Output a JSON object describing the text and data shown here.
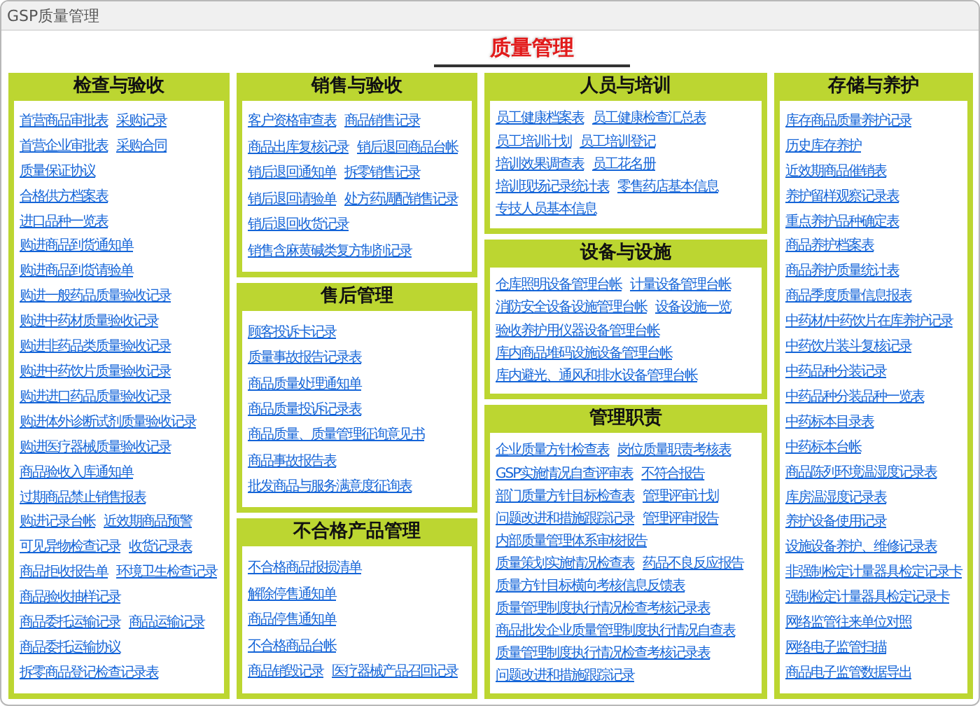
{
  "window": {
    "title": "GSP质量管理"
  },
  "heading": "质量管理",
  "columns": [
    {
      "panels": [
        {
          "title": "检查与验收",
          "rows": [
            [
              "首营商品审批表",
              "采购记录"
            ],
            [
              "首营企业审批表",
              "采购合同"
            ],
            [
              "质量保证协议"
            ],
            [
              "合格供方档案表"
            ],
            [
              "进口品种一览表"
            ],
            [
              "购进商品到货通知单"
            ],
            [
              "购进商品到货请验单"
            ],
            [
              "购进一般药品质量验收记录"
            ],
            [
              "购进中药材质量验收记录"
            ],
            [
              "购进非药品类质量验收记录"
            ],
            [
              "购进中药饮片质量验收记录"
            ],
            [
              "购进进口药品质量验收记录"
            ],
            [
              "购进体外诊断试剂质量验收记录"
            ],
            [
              "购进医疗器械质量验收记录"
            ],
            [
              "商品验收入库通知单"
            ],
            [
              "过期商品禁止销售报表"
            ],
            [
              "购进记录台帐",
              "近效期商品预警"
            ],
            [
              "可见异物检查记录",
              "收货记录表"
            ],
            [
              "商品拒收报告单",
              "环境卫生检查记录"
            ],
            [
              "商品验收抽样记录"
            ],
            [
              "商品委托运输记录",
              "商品运输记录"
            ],
            [
              "商品委托运输协议"
            ],
            [
              "拆零商品登记检查记录表"
            ]
          ]
        }
      ]
    },
    {
      "panels": [
        {
          "title": "销售与验收",
          "rows": [
            [
              "客户资格审查表",
              "商品销售记录"
            ],
            [
              "商品出库复核记录",
              "销后退回商品台帐"
            ],
            [
              "销后退回通知单",
              "拆零销售记录"
            ],
            [
              "销后退回请验单",
              "处方药调配销售记录"
            ],
            [
              "销后退回收货记录"
            ],
            [
              "销售含麻黄碱类复方制剂记录"
            ]
          ]
        },
        {
          "title": "售后管理",
          "rows": [
            [
              "顾客投诉卡记录"
            ],
            [
              "质量事故报告记录表"
            ],
            [
              "商品质量处理通知单"
            ],
            [
              "商品质量投诉记录表"
            ],
            [
              "商品质量、质量管理征询意见书"
            ],
            [
              "商品事故报告表"
            ],
            [
              "批发商品与服务满意度征询表"
            ]
          ]
        },
        {
          "title": "不合格产品管理",
          "rows": [
            [
              "不合格商品报损清单"
            ],
            [
              "解除停售通知单"
            ],
            [
              "商品停售通知单"
            ],
            [
              "不合格商品台帐"
            ],
            [
              "商品销毁记录",
              "医疗器械产品召回记录"
            ]
          ]
        }
      ]
    },
    {
      "panels": [
        {
          "title": "人员与培训",
          "rows": [
            [
              "员工健康档案表",
              "员工健康检查汇总表"
            ],
            [
              "员工培训计划",
              "员工培训登记"
            ],
            [
              "培训效果调查表",
              "员工花名册"
            ],
            [
              "培训现场记录统计表",
              "零售药店基本信息"
            ],
            [
              "专技人员基本信息"
            ]
          ]
        },
        {
          "title": "设备与设施",
          "rows": [
            [
              "仓库照明设备管理台帐",
              "计量设备管理台帐"
            ],
            [
              "消防安全设备设施管理台帐",
              "设备设施一览"
            ],
            [
              "验收养护用仪器设备管理台帐"
            ],
            [
              "库内商品堆码设施设备管理台帐"
            ],
            [
              "库内避光、通风和排水设备管理台帐"
            ]
          ]
        },
        {
          "title": "管理职责",
          "rows": [
            [
              "企业质量方针检查表",
              "岗位质量职责考核表"
            ],
            [
              "GSP实施情况自查评审表",
              "不符合报告"
            ],
            [
              "部门质量方针目标检查表",
              "管理评审计划"
            ],
            [
              "问题改进和措施跟踪记录",
              "管理评审报告"
            ],
            [
              "内部质量管理体系审核报告"
            ],
            [
              "质量策划实施情况检查表",
              "药品不良反应报告"
            ],
            [
              "质量方针目标横向考核信息反馈表"
            ],
            [
              "质量管理制度执行情况检查考核记录表"
            ],
            [
              "商品批发企业质量管理制度执行情况自查表"
            ],
            [
              "质量管理制度执行情况检查考核记录表"
            ],
            [
              "问题改进和措施跟踪记录"
            ]
          ]
        }
      ]
    },
    {
      "panels": [
        {
          "title": "存储与养护",
          "rows": [
            [
              "库存商品质量养护记录"
            ],
            [
              "历史库存养护"
            ],
            [
              "近效期商品催销表"
            ],
            [
              "养护留样观察记录表"
            ],
            [
              "重点养护品种确定表"
            ],
            [
              "商品养护档案表"
            ],
            [
              "商品养护质量统计表"
            ],
            [
              "商品季度质量信息报表"
            ],
            [
              "中药材/中药饮片在库养护记录"
            ],
            [
              "中药饮片装斗复核记录"
            ],
            [
              "中药品种分装记录"
            ],
            [
              "中药品种分装品种一览表"
            ],
            [
              "中药标本目录表"
            ],
            [
              "中药标本台帐"
            ],
            [
              "商品陈列环境温湿度记录表"
            ],
            [
              "库房温湿度记录表"
            ],
            [
              "养护设备使用记录"
            ],
            [
              "设施设备养护、维修记录表"
            ],
            [
              "非强制检定计量器具检定记录卡"
            ],
            [
              "强制检定计量器具检定记录卡"
            ],
            [
              "网络监管往来单位对照"
            ],
            [
              "网络电子监管扫描"
            ],
            [
              "商品电子监管数据导出"
            ]
          ]
        }
      ]
    }
  ]
}
